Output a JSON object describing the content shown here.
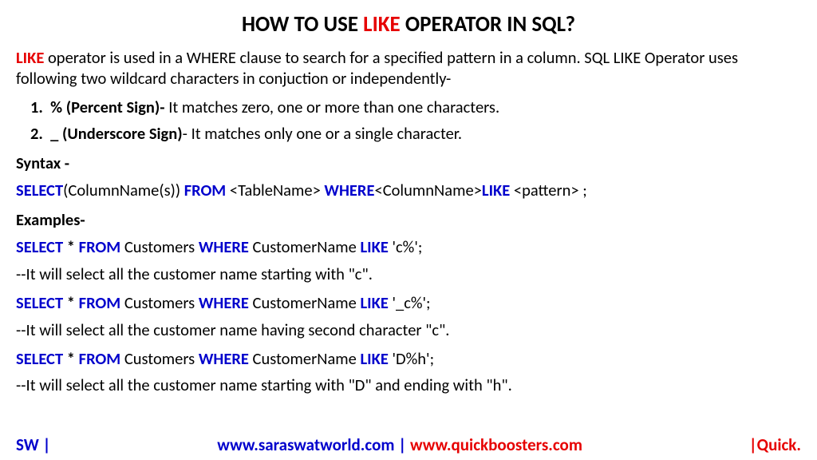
{
  "title": {
    "pre": "HOW TO USE ",
    "highlight": "LIKE",
    "post": " OPERATOR IN SQL?"
  },
  "intro": {
    "leadHighlight": "LIKE",
    "rest": " operator is used in a WHERE clause to search for a specified pattern in a column. SQL LIKE Operator uses following two wildcard characters in conjuction or independently-"
  },
  "item1": {
    "num": "1.",
    "bold": "% (Percent Sign)-",
    "rest": " It matches zero, one or more than one characters."
  },
  "item2": {
    "num": "2.",
    "bold": "_ (Underscore Sign)",
    "rest": "- It matches only one or a single character."
  },
  "syntaxLabel": "Syntax -",
  "syntax": {
    "select": "SELECT",
    "colPart": "(ColumnName(s)) ",
    "from": "FROM",
    "tablePart": " <TableName> ",
    "where": "WHERE",
    "colName": "<ColumnName>",
    "like": "LIKE",
    "patternPart": " <pattern> ;"
  },
  "examplesLabel": "Examples-",
  "ex": {
    "select": "SELECT",
    "star": " * ",
    "from": "FROM",
    "table": " Customers ",
    "where": "WHERE",
    "col": " CustomerName ",
    "like": "LIKE"
  },
  "ex1": {
    "pattern": " 'c%';",
    "comment": "--It will select all the customer name starting with \"c\"."
  },
  "ex2": {
    "pattern": " '_c%';",
    "comment": "--It will select all the customer name having second character  \"c\"."
  },
  "ex3": {
    "pattern": " 'D%h';",
    "comment": "--It will select all the customer name starting with \"D\" and ending with \"h\"."
  },
  "footer": {
    "left": "SW |",
    "centerBlue": "www.saraswatworld.com | ",
    "centerRed": "www.quickboosters.com",
    "right": "|Quick."
  }
}
